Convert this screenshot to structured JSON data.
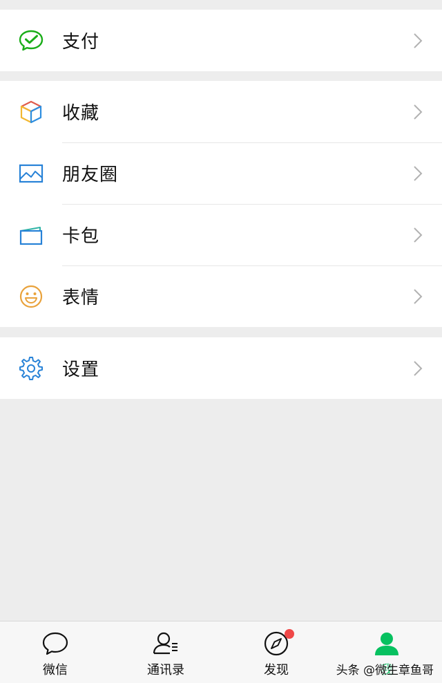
{
  "groups": {
    "pay": {
      "label": "支付",
      "icon": "wechat-pay-icon",
      "color": "#1aad19"
    },
    "favorites": {
      "label": "收藏",
      "icon": "cube-icon"
    },
    "moments": {
      "label": "朋友圈",
      "icon": "image-icon",
      "color": "#2782d7"
    },
    "cards": {
      "label": "卡包",
      "icon": "wallet-icon",
      "color": "#2782d7"
    },
    "stickers": {
      "label": "表情",
      "icon": "smiley-icon",
      "color": "#e9a23b"
    },
    "settings": {
      "label": "设置",
      "icon": "gear-icon",
      "color": "#2782d7"
    }
  },
  "tabbar": {
    "chats": "微信",
    "contacts": "通讯录",
    "discover": "发现",
    "me": "我",
    "active_color": "#07c160",
    "badge_color": "#f04848"
  },
  "watermark": "头条 @微生章鱼哥"
}
